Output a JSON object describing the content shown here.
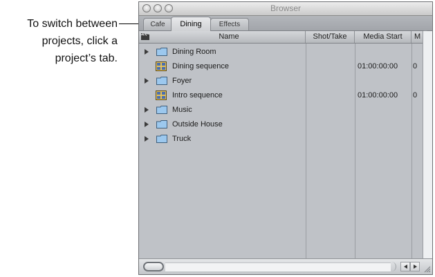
{
  "callout": {
    "line1": "To switch between",
    "line2": "projects, click a",
    "line3": "project’s tab."
  },
  "window": {
    "title": "Browser",
    "tabs": [
      {
        "label": "Cafe",
        "active": false
      },
      {
        "label": "Dining",
        "active": true
      },
      {
        "label": "Effects",
        "active": false
      }
    ],
    "columns": {
      "name": "Name",
      "shot_take": "Shot/Take",
      "media_start": "Media Start",
      "extra": "M"
    },
    "rows": [
      {
        "type": "folder",
        "name": "Dining Room",
        "media_start": "",
        "extra": ""
      },
      {
        "type": "sequence",
        "name": "Dining sequence",
        "media_start": "01:00:00:00",
        "extra": "0"
      },
      {
        "type": "folder",
        "name": "Foyer",
        "media_start": "",
        "extra": ""
      },
      {
        "type": "sequence",
        "name": "Intro sequence",
        "media_start": "01:00:00:00",
        "extra": "0"
      },
      {
        "type": "folder",
        "name": "Music",
        "media_start": "",
        "extra": ""
      },
      {
        "type": "folder",
        "name": "Outside House",
        "media_start": "",
        "extra": ""
      },
      {
        "type": "folder",
        "name": "Truck",
        "media_start": "",
        "extra": ""
      }
    ],
    "icons": {
      "folder": "folder-icon",
      "sequence": "sequence-icon",
      "disclosure": "disclosure-triangle-icon",
      "header": "clapper-icon"
    },
    "colors": {
      "list_background": "#bfc2c7",
      "folder_fill": "#9cc8ee",
      "sequence_fill": "#e6c25a"
    }
  }
}
